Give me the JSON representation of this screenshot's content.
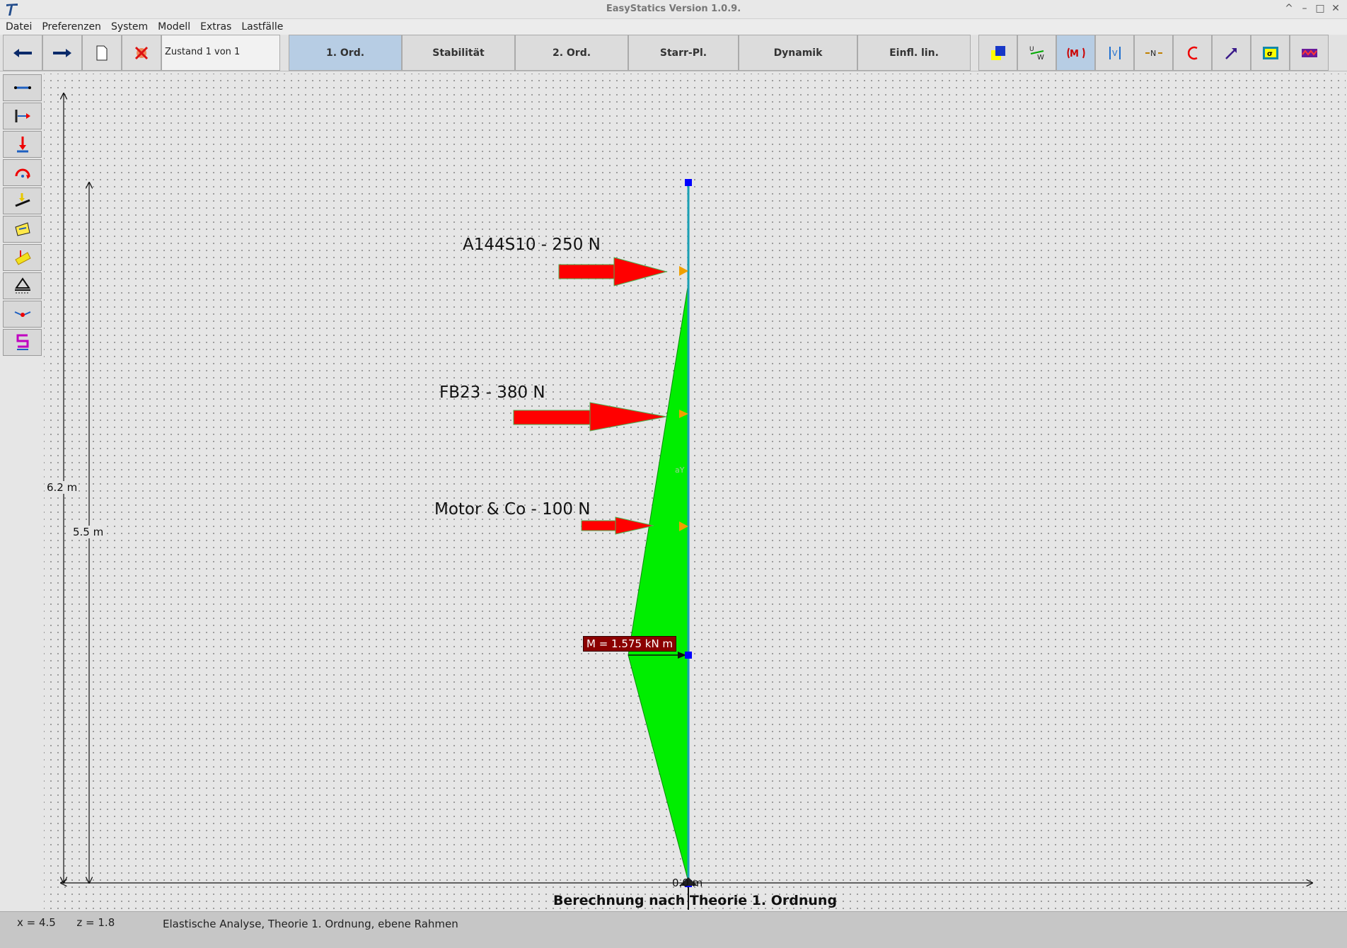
{
  "window": {
    "title": "EasyStatics Version 1.0.9."
  },
  "window_controls": [
    "^",
    "–",
    "□",
    "✕"
  ],
  "menu": [
    "Datei",
    "Preferenzen",
    "System",
    "Modell",
    "Extras",
    "Lastfälle"
  ],
  "toolbar": {
    "state_label": "Zustand 1 von  1",
    "tabs": [
      {
        "label": "1. Ord.",
        "active": true
      },
      {
        "label": "Stabilität",
        "active": false
      },
      {
        "label": "2. Ord.",
        "active": false
      },
      {
        "label": "Starr-Pl.",
        "active": false
      },
      {
        "label": "Dynamik",
        "active": false
      },
      {
        "label": "Einfl. lin.",
        "active": false
      }
    ],
    "right_tools": [
      "deformation-icon",
      "uw-displacement-icon",
      "moment-icon",
      "shear-icon",
      "normal-force-icon",
      "reaction-icon",
      "vector-icon",
      "stress-icon",
      "spectrum-icon"
    ],
    "active_right_tool": "moment-icon"
  },
  "left_tools": [
    "beam-tool-icon",
    "support-tool-icon",
    "vertical-load-tool-icon",
    "rotation-load-tool-icon",
    "line-load-tool-icon",
    "temperature-tool-icon",
    "area-load-tool-icon",
    "foundation-tool-icon",
    "hinge-tool-icon",
    "spring-tool-icon"
  ],
  "canvas": {
    "loads": [
      {
        "label": "A144S10 - 250 N"
      },
      {
        "label": "FB23 - 380 N"
      },
      {
        "label": "Motor & Co - 100 N"
      }
    ],
    "dimensions": {
      "total_height": "6.2 m",
      "sub_height": "5.5 m",
      "base": "0.0 m"
    },
    "moment_label": "M = 1.575 kN m",
    "member_tag": "aY",
    "title": "Berechnung nach Theorie 1. Ordnung",
    "colors": {
      "moment_area": "#00ee00",
      "load_arrow": "#ff0000",
      "member": "#1aa0b4",
      "node": "#0000ff"
    }
  },
  "status": {
    "x_label": "x = 4.5",
    "z_label": "z = 1.8",
    "description": "Elastische Analyse, Theorie 1. Ordnung, ebene Rahmen"
  }
}
